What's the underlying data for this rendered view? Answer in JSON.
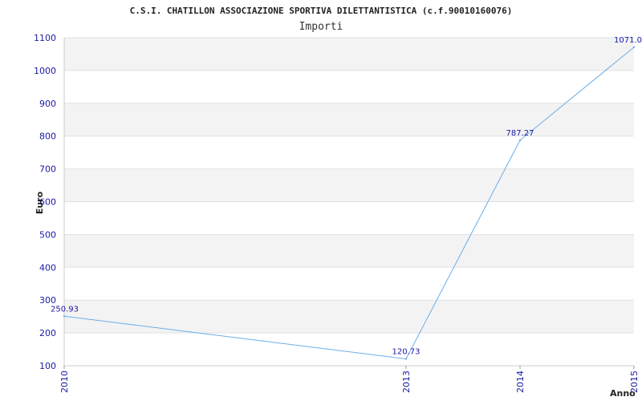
{
  "chart_data": {
    "type": "line",
    "title": "C.S.I. CHATILLON ASSOCIAZIONE SPORTIVA DILETTANTISTICA (c.f.90010160076)",
    "subtitle": "Importi",
    "xlabel": "Anno",
    "ylabel": "Euro",
    "x": [
      "2010",
      "2013",
      "2014",
      "2015"
    ],
    "values": [
      250.93,
      120.73,
      787.27,
      1071.0
    ],
    "data_labels": [
      "250.93",
      "120.73",
      "787.27",
      "1071.0"
    ],
    "ylim": [
      100,
      1100
    ],
    "yticks": [
      100,
      200,
      300,
      400,
      500,
      600,
      700,
      800,
      900,
      1000,
      1100
    ],
    "grid": true,
    "colors": {
      "line": "#6aaee8",
      "band": "#f3f3f3",
      "tick_text": "#1a1aa6"
    }
  }
}
